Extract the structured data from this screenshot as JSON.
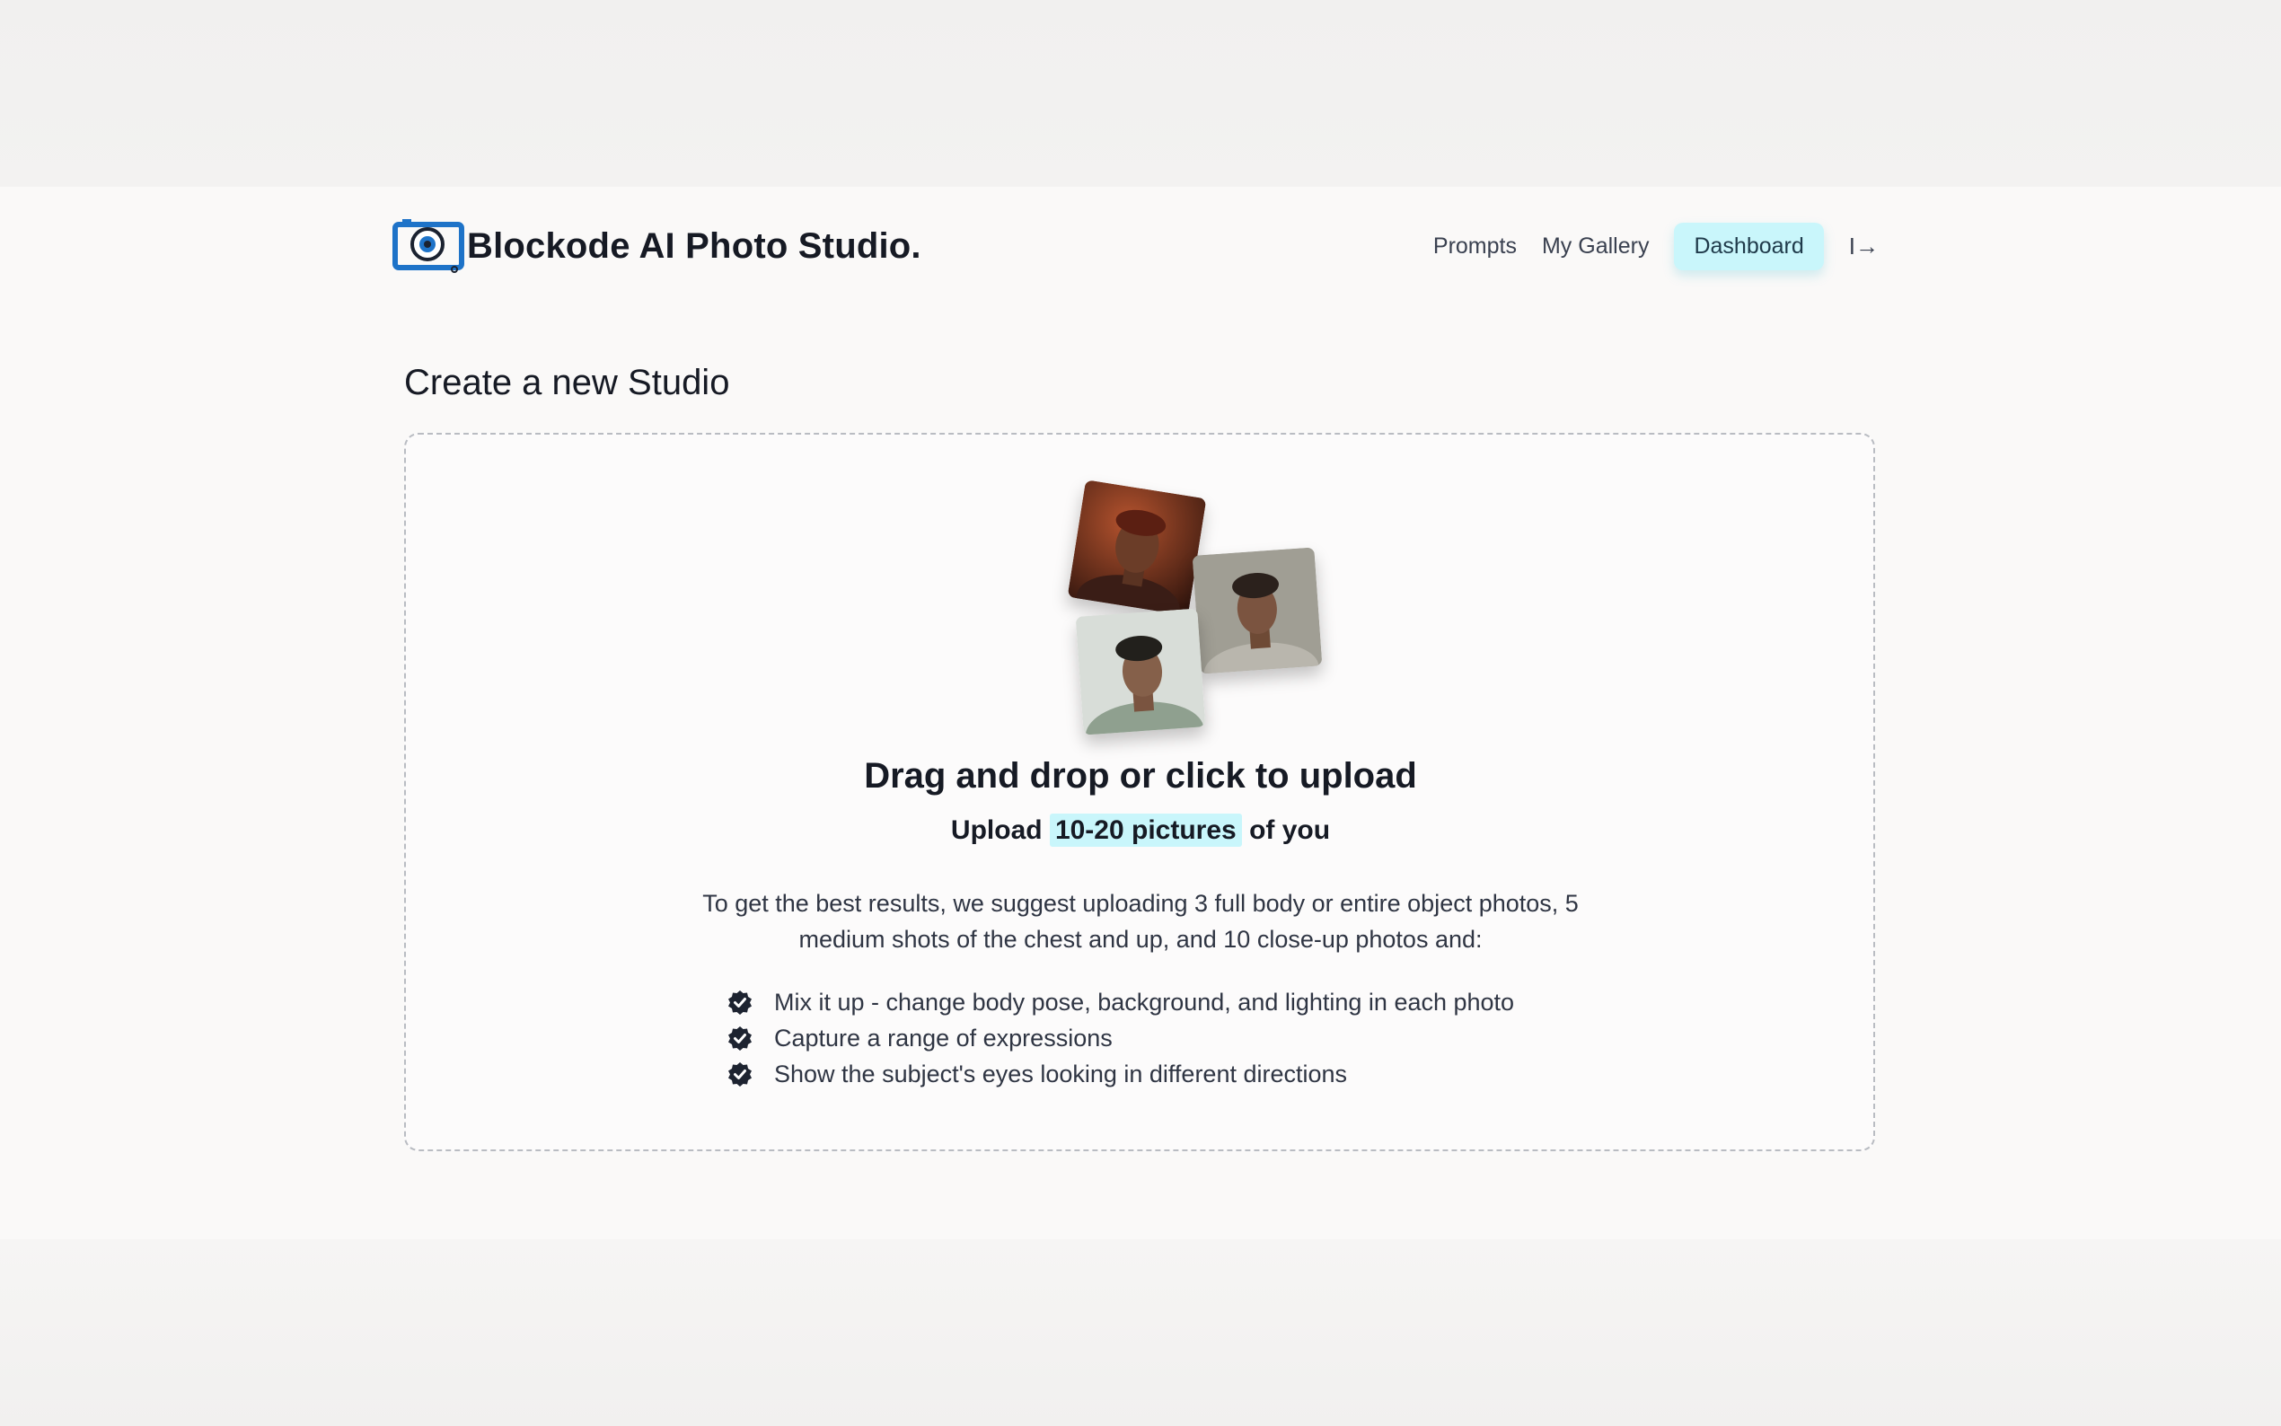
{
  "header": {
    "brand": "Blockode AI Photo Studio.",
    "nav": [
      {
        "label": "Prompts"
      },
      {
        "label": "My Gallery"
      },
      {
        "label": "Dashboard",
        "active": true
      }
    ],
    "exit_glyph": "I→",
    "icons": {
      "logo": "camera-lens-icon",
      "exit": "logout-icon"
    }
  },
  "main": {
    "title": "Create a new Studio",
    "upload": {
      "heading": "Drag and drop or click to upload",
      "sub_prefix": "Upload",
      "sub_highlight": "10-20 pictures",
      "sub_suffix": "of you",
      "description": "To get the best results, we suggest uploading 3 full body or entire object photos, 5 medium shots of the chest and up, and 10 close-up photos and:",
      "tips": [
        "Mix it up - change body pose, background, and lighting in each photo",
        "Capture a range of expressions",
        "Show the subject's eyes looking in different directions"
      ],
      "tip_icon": "verified-check-icon"
    }
  },
  "colors": {
    "accent": "#c9f6fb",
    "logo_blue": "#1e73c8",
    "text": "#161a24"
  }
}
